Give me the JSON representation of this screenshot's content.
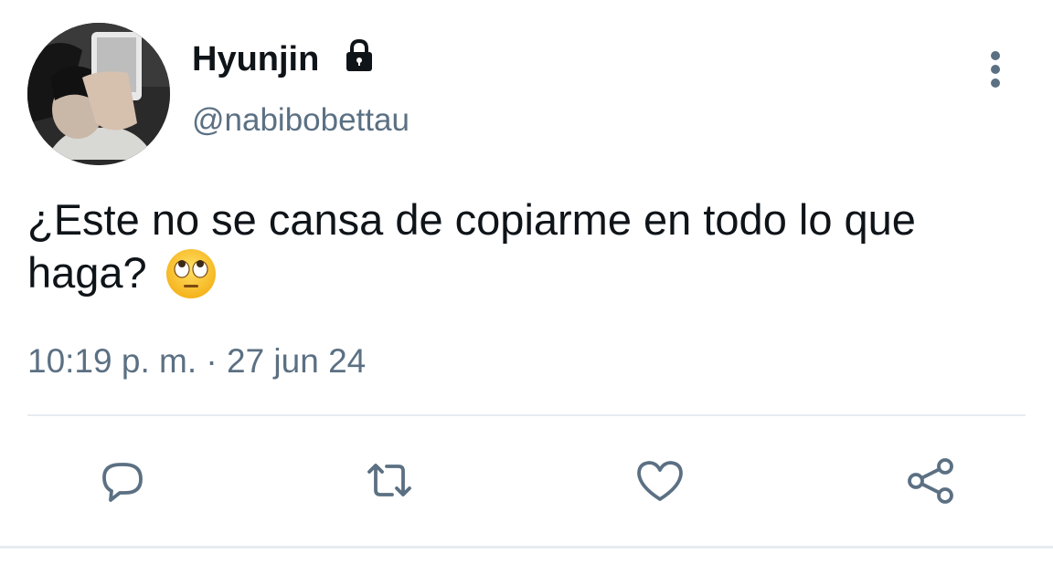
{
  "user": {
    "display_name": "Hyunjin",
    "handle": "@nabibobettau",
    "protected_icon": "lock-icon",
    "avatar": "profile-photo"
  },
  "tweet": {
    "text": "¿Este no se cansa de copiarme en todo lo que haga?",
    "emoji": "face-with-rolling-eyes",
    "timestamp": "10:19 p. m. · 27 jun 24"
  },
  "actions": [
    {
      "name": "reply",
      "icon": "comment-icon"
    },
    {
      "name": "retweet",
      "icon": "retweet-icon"
    },
    {
      "name": "like",
      "icon": "heart-icon"
    },
    {
      "name": "share",
      "icon": "share-icon"
    }
  ],
  "colors": {
    "text_primary": "#0f1419",
    "text_secondary": "#5b7083",
    "icon": "#5b7083",
    "divider": "#e6ecf0"
  }
}
